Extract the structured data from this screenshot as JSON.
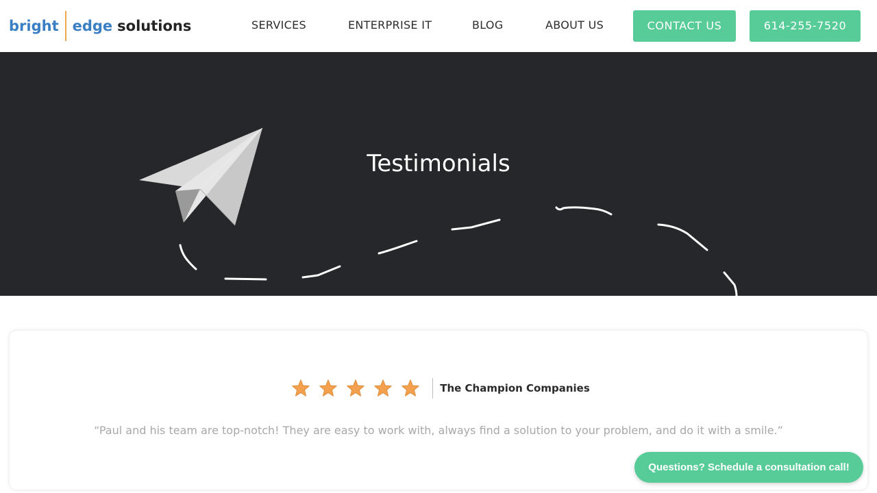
{
  "header": {
    "logo": {
      "word1": "bright",
      "word2": "edge",
      "word3": "solutions"
    },
    "nav": {
      "services": "SERVICES",
      "enterprise_it": "ENTERPRISE IT",
      "blog": "BLOG",
      "about_us": "ABOUT US"
    },
    "contact_button": "CONTACT US",
    "phone_button": "614-255-7520"
  },
  "hero": {
    "title": "Testimonials",
    "illustration_icon": "paper-plane-icon"
  },
  "testimonial": {
    "rating": 5,
    "rating_max": 5,
    "star_icon": "star-icon",
    "company": "The Champion Companies",
    "quote": "“Paul and his team are top-notch! They are easy to work with, always find a solution to your problem, and do it with a smile.”"
  },
  "cta": {
    "label": "Questions? Schedule a consultation call!"
  },
  "colors": {
    "accent_green": "#58cc98",
    "hero_background": "#25272b",
    "logo_blue": "#3a7fc4",
    "logo_divider": "#f0a64a",
    "star_orange": "#f3a14e"
  }
}
